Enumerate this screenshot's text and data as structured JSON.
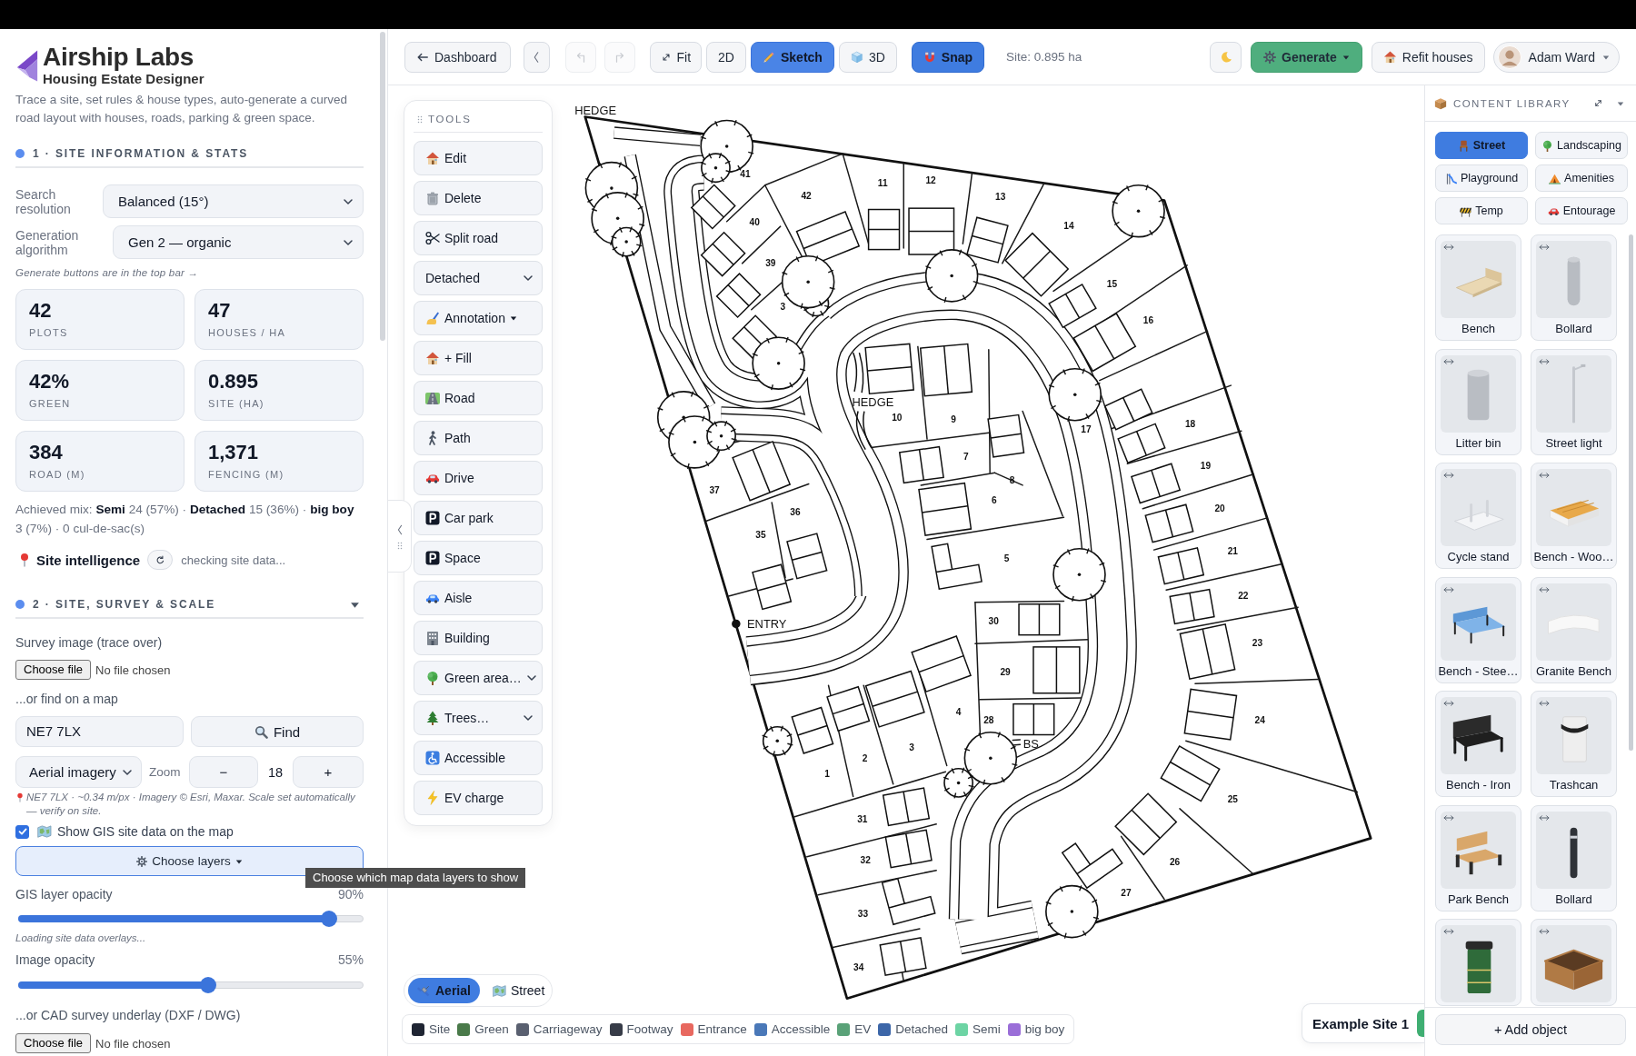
{
  "app": {
    "name": "Airship Labs",
    "subtitle": "Housing Estate Designer",
    "description": "Trace a site, set rules & house types, auto-generate a curved road layout with houses, roads, parking & green space."
  },
  "section_1": {
    "title": "1 · SITE INFORMATION & STATS",
    "settings": [
      {
        "label": "Search resolution",
        "value": "Balanced (15°)"
      },
      {
        "label": "Generation algorithm",
        "value": "Gen 2 — organic"
      }
    ],
    "hint": "Generate buttons are in the top bar →",
    "stats": [
      {
        "value": "42",
        "label": "PLOTS"
      },
      {
        "value": "47",
        "label": "HOUSES / HA"
      },
      {
        "value": "42%",
        "label": "GREEN"
      },
      {
        "value": "0.895",
        "label": "SITE (HA)"
      },
      {
        "value": "384",
        "label": "ROAD (M)"
      },
      {
        "value": "1,371",
        "label": "FENCING (M)"
      }
    ],
    "achieved_mix": "Achieved mix: **Semi** 24 (57%) · **Detached** 15 (36%) · **big boy** 3 (7%) · 0 cul-de-sac(s)",
    "site_intelligence": {
      "title": "Site intelligence",
      "status": "checking site data..."
    }
  },
  "section_2": {
    "title": "2 · SITE, SURVEY & SCALE",
    "expanded": true,
    "survey_image": {
      "label": "Survey image (trace over)",
      "button": "Choose file",
      "status": "No file chosen"
    },
    "map_search": {
      "label": "...or find on a map",
      "value": "NE7 7LX",
      "button": "Find"
    },
    "imagery": {
      "source": "Aerial imagery",
      "zoom_label": "Zoom",
      "zoom_out": "−",
      "zoom_value": "18",
      "zoom_in": "+",
      "note": "NE7 7LX · ~0.34 m/px · Imagery © Esri, Maxar. Scale set automatically — verify on site."
    },
    "gis": {
      "checked": true,
      "label": "Show GIS site data on the map",
      "layers_button": "Choose layers",
      "opacity_label": "GIS layer opacity",
      "opacity_value": "90%",
      "level": 0.9,
      "status": "Loading site data overlays..."
    },
    "image_opacity": {
      "label": "Image opacity",
      "value": "55%",
      "level": 0.55
    },
    "cad_underlay": {
      "label": "...or CAD survey underlay (DXF / DWG)",
      "button": "Choose file",
      "status": "No file chosen"
    }
  },
  "tooltip": "Choose which map data layers to show",
  "toolbar": {
    "back": "Dashboard",
    "history": [
      {
        "disabled": true
      },
      {
        "disabled": true
      }
    ],
    "fit": "Fit",
    "view_modes": [
      {
        "label": "2D",
        "selected": false
      },
      {
        "label": "Sketch",
        "selected": true
      },
      {
        "label": "3D",
        "selected": false
      }
    ],
    "snap": {
      "label": "Snap",
      "on": true
    },
    "site_area": "Site: 0.895 ha",
    "generate": "Generate",
    "refit": "Refit houses",
    "user": "Adam Ward"
  },
  "tools": {
    "title": "TOOLS",
    "items": [
      {
        "label": "Edit",
        "kind": "button"
      },
      {
        "label": "Delete",
        "kind": "button"
      },
      {
        "label": "Split road",
        "kind": "button"
      },
      {
        "label": "Detached",
        "kind": "select"
      },
      {
        "label": "Annotation",
        "kind": "menu"
      },
      {
        "label": "+ Fill",
        "kind": "button"
      },
      {
        "label": "Road",
        "kind": "button"
      },
      {
        "label": "Path",
        "kind": "button"
      },
      {
        "label": "Drive",
        "kind": "button"
      },
      {
        "label": "Car park",
        "kind": "button"
      },
      {
        "label": "Space",
        "kind": "button"
      },
      {
        "label": "Aisle",
        "kind": "button"
      },
      {
        "label": "Building",
        "kind": "button"
      },
      {
        "label": "Green area…",
        "kind": "select"
      },
      {
        "label": "Trees…",
        "kind": "select"
      },
      {
        "label": "Accessible",
        "kind": "button"
      },
      {
        "label": "EV charge",
        "kind": "button"
      }
    ]
  },
  "map": {
    "plan": {
      "plot_numbers": [
        "1",
        "2",
        "3",
        "4",
        "5",
        "6",
        "7",
        "8",
        "9",
        "10",
        "11",
        "12",
        "13",
        "14",
        "15",
        "16",
        "17",
        "18",
        "19",
        "20",
        "21",
        "22",
        "23",
        "24",
        "25",
        "26",
        "27",
        "28",
        "29",
        "30",
        "31",
        "32",
        "33",
        "34",
        "35",
        "36",
        "37",
        "3",
        "39",
        "40",
        "41",
        "42"
      ],
      "notes": [
        "HEDGE",
        "HEDGE",
        "ENTRY",
        "BS"
      ]
    },
    "view_toggle": [
      {
        "label": "Aerial",
        "selected": true
      },
      {
        "label": "Street",
        "selected": false
      }
    ],
    "legend": [
      {
        "label": "Site",
        "color": "#1f2533"
      },
      {
        "label": "Green",
        "color": "#4a7a4a"
      },
      {
        "label": "Carriageway",
        "color": "#5a6070"
      },
      {
        "label": "Footway",
        "color": "#373c48"
      },
      {
        "label": "Entrance",
        "color": "#e8685f"
      },
      {
        "label": "Accessible",
        "color": "#4a78b8"
      },
      {
        "label": "EV",
        "color": "#5aa278"
      },
      {
        "label": "Detached",
        "color": "#3c66a8"
      },
      {
        "label": "Semi",
        "color": "#6dd4a4"
      },
      {
        "label": "big boy",
        "color": "#9a6ed8"
      }
    ],
    "site_tab": "Example Site 1"
  },
  "library": {
    "title": "CONTENT LIBRARY",
    "categories": [
      {
        "label": "Street",
        "selected": true
      },
      {
        "label": "Landscaping",
        "selected": false
      },
      {
        "label": "Playground",
        "selected": false
      },
      {
        "label": "Amenities",
        "selected": false
      },
      {
        "label": "Temp",
        "selected": false
      },
      {
        "label": "Entourage",
        "selected": false
      }
    ],
    "items": [
      {
        "name": "Bench",
        "kind": "bench"
      },
      {
        "name": "Bollard",
        "kind": "bollard"
      },
      {
        "name": "Litter bin",
        "kind": "litter-bin"
      },
      {
        "name": "Street light",
        "kind": "street-light"
      },
      {
        "name": "Cycle stand",
        "kind": "cycle-stand"
      },
      {
        "name": "Bench - Woo…",
        "kind": "wood-bench"
      },
      {
        "name": "Bench - Stee…",
        "kind": "steel-bench"
      },
      {
        "name": "Granite Bench",
        "kind": "granite-bench"
      },
      {
        "name": "Bench - Iron",
        "kind": "iron-bench"
      },
      {
        "name": "Trashcan",
        "kind": "trashcan"
      },
      {
        "name": "Park Bench",
        "kind": "park-bench"
      },
      {
        "name": "Bollard",
        "kind": "post-bollard"
      },
      {
        "kind": "wheelie-bin"
      },
      {
        "kind": "planter"
      }
    ],
    "add_button": "+ Add object"
  }
}
